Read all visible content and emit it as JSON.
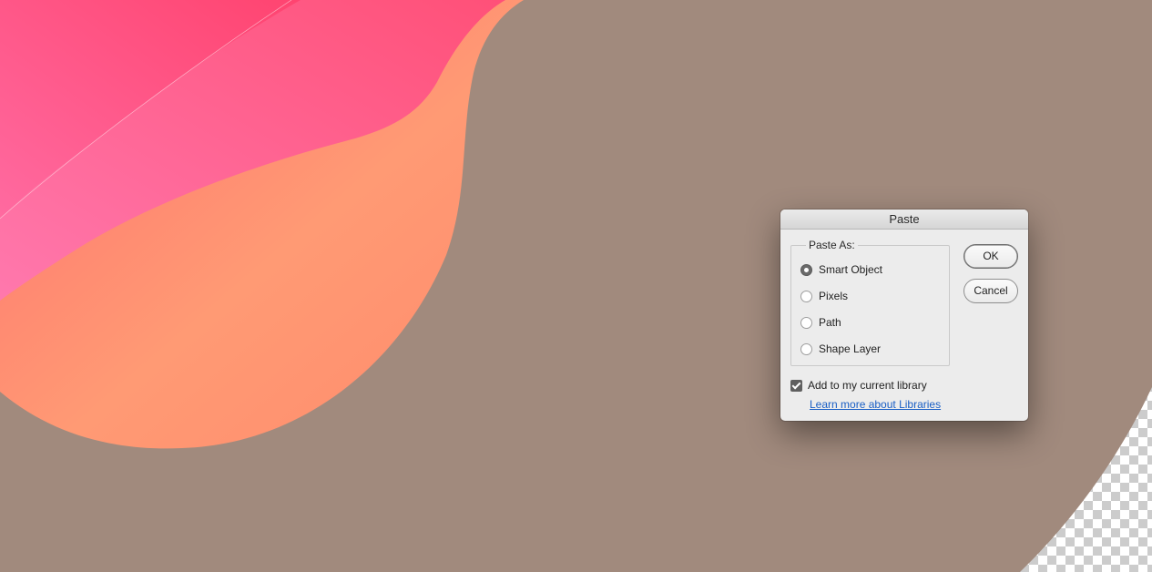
{
  "dialog": {
    "title": "Paste",
    "group_label": "Paste As:",
    "options": [
      {
        "label": "Smart Object",
        "selected": true
      },
      {
        "label": "Pixels",
        "selected": false
      },
      {
        "label": "Path",
        "selected": false
      },
      {
        "label": "Shape Layer",
        "selected": false
      }
    ],
    "ok_label": "OK",
    "cancel_label": "Cancel",
    "library_checkbox": {
      "label": "Add to my current library",
      "checked": true
    },
    "learn_more_link": "Learn more about Libraries"
  },
  "colors": {
    "background": "#a18a7d",
    "pink": "#ff5b8f",
    "coral": "#ff7d6a",
    "peach": "#ff9b76",
    "link": "#1a5fc5"
  }
}
